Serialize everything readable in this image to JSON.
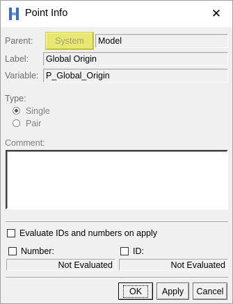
{
  "window": {
    "title": "Point Info",
    "close_glyph": "✕",
    "app_icon": "hyperworks-logo-icon"
  },
  "form": {
    "parent_label": "Parent:",
    "parent_system_button": "System",
    "parent_value": "Model",
    "label_label": "Label:",
    "label_value": "Global Origin",
    "variable_label": "Variable:",
    "variable_value": "P_Global_Origin",
    "type_label": "Type:",
    "type_options": [
      {
        "label": "Single",
        "selected": true
      },
      {
        "label": "Pair",
        "selected": false
      }
    ],
    "comment_label": "Comment:",
    "comment_value": ""
  },
  "evaluate": {
    "checkbox_label": "Evaluate IDs and numbers on apply",
    "checked": false,
    "number_label": "Number:",
    "number_checked": false,
    "number_status": "Not Evaluated",
    "id_label": "ID:",
    "id_checked": false,
    "id_status": "Not Evaluated"
  },
  "buttons": {
    "ok": "OK",
    "apply": "Apply",
    "cancel": "Cancel"
  },
  "colors": {
    "system_button_bg": "#e8e870",
    "system_button_text": "#a2a27a",
    "dialog_bg": "#f0f0f0",
    "icon_blue": "#3a6cc8"
  }
}
